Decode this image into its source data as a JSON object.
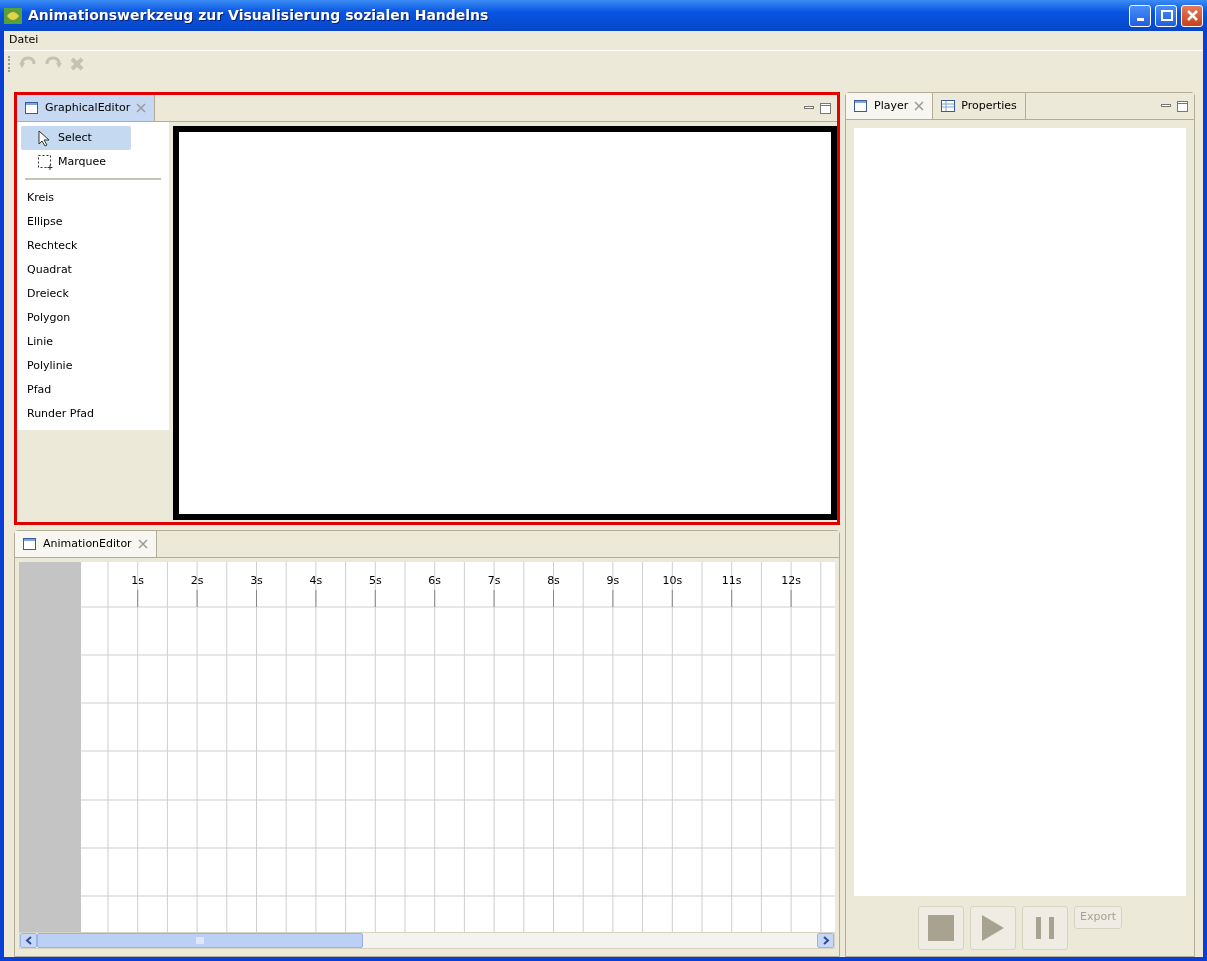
{
  "window": {
    "title": "Animationswerkzeug zur Visualisierung sozialen Handelns"
  },
  "menu": [
    {
      "label": "Datei"
    }
  ],
  "toolbar": [
    {
      "kind": "undo",
      "disabled": true
    },
    {
      "kind": "redo",
      "disabled": true
    },
    {
      "kind": "delete",
      "disabled": true
    }
  ],
  "graphical_editor": {
    "active": true,
    "tab": {
      "label": "GraphicalEditor",
      "selected": true
    },
    "palette": {
      "tools": [
        {
          "kind": "select",
          "label": "Select",
          "selected": true
        },
        {
          "kind": "marquee",
          "label": "Marquee",
          "selected": false
        }
      ],
      "shapes": [
        {
          "label": "Kreis",
          "selected": false
        },
        {
          "label": "Ellipse",
          "selected": false
        },
        {
          "label": "Rechteck",
          "selected": false
        },
        {
          "label": "Quadrat",
          "selected": false
        },
        {
          "label": "Dreieck",
          "selected": false
        },
        {
          "label": "Polygon",
          "selected": false
        },
        {
          "label": "Linie",
          "selected": false
        },
        {
          "label": "Polylinie",
          "selected": false
        },
        {
          "label": "Pfad",
          "selected": false
        },
        {
          "label": "Runder Pfad",
          "selected": false
        }
      ]
    }
  },
  "animation_editor": {
    "active": false,
    "tab": {
      "label": "AnimationEditor",
      "selected": true
    },
    "timeline": {
      "ticks": [
        "1s",
        "2s",
        "3s",
        "4s",
        "5s",
        "6s",
        "7s",
        "8s",
        "9s",
        "10s",
        "11s",
        "12s"
      ]
    }
  },
  "side_panel": {
    "active": false,
    "tabs": [
      {
        "label": "Player",
        "selected": true,
        "closable": true
      },
      {
        "label": "Properties",
        "selected": false,
        "closable": false
      }
    ],
    "controls": [
      {
        "kind": "stop",
        "disabled": true
      },
      {
        "kind": "play",
        "disabled": true
      },
      {
        "kind": "pause",
        "disabled": true
      },
      {
        "kind": "export",
        "label": "Export",
        "disabled": true
      }
    ]
  }
}
